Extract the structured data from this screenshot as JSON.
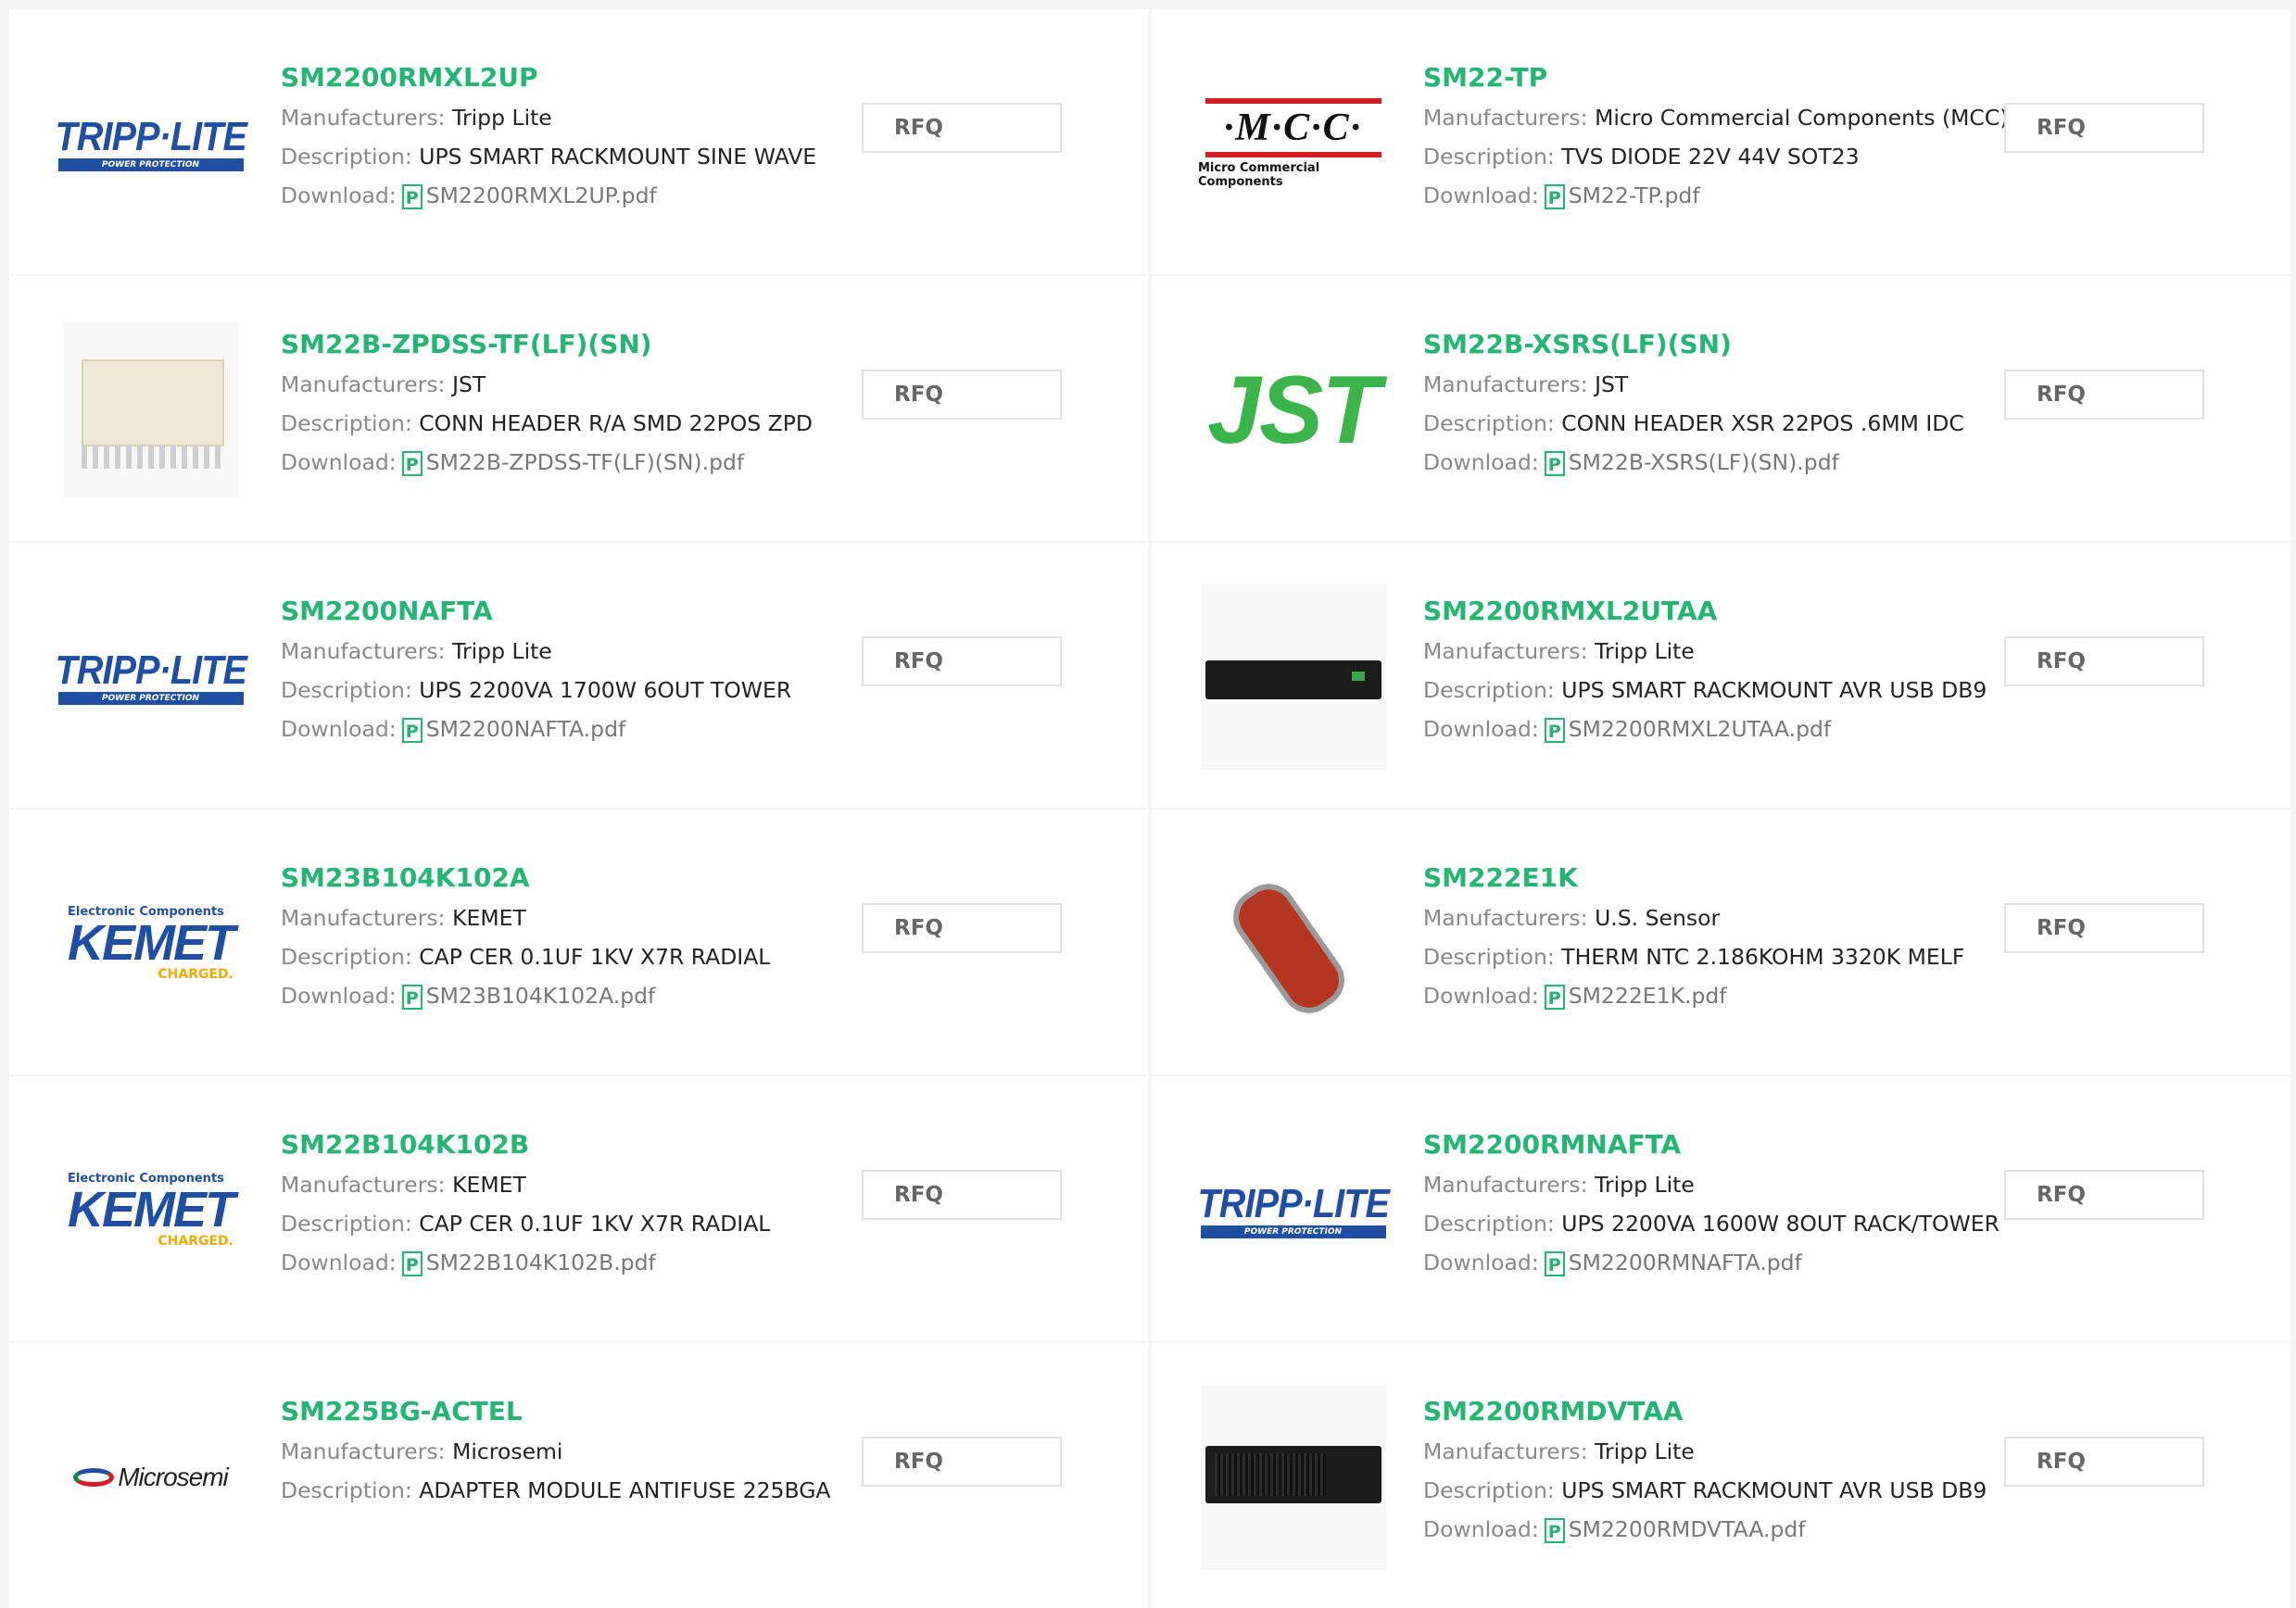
{
  "labels": {
    "manufacturers": "Manufacturers:",
    "description": "Description:",
    "download": "Download:",
    "rfq": "RFQ",
    "pdf_glyph": "P"
  },
  "colors": {
    "accent": "#22b573",
    "label": "#888888",
    "text": "#222222"
  },
  "products": [
    {
      "part": "SM2200RMXL2UP",
      "manufacturer": "Tripp Lite",
      "description": "UPS SMART RACKMOUNT SINE WAVE",
      "download": "SM2200RMXL2UP.pdf",
      "logo": "tripp-lite-logo",
      "logo_sub": "POWER PROTECTION"
    },
    {
      "part": "SM22-TP",
      "manufacturer": "Micro Commercial Components (MCC)",
      "description": "TVS DIODE 22V 44V SOT23",
      "download": "SM22-TP.pdf",
      "logo": "mcc-logo",
      "logo_text": "·M·C·C·",
      "logo_sub": "Micro Commercial Components"
    },
    {
      "part": "SM22B-ZPDSS-TF(LF)(SN)",
      "manufacturer": "JST",
      "description": "CONN HEADER R/A SMD 22POS ZPD",
      "download": "SM22B-ZPDSS-TF(LF)(SN).pdf",
      "logo": "connector-photo"
    },
    {
      "part": "SM22B-XSRS(LF)(SN)",
      "manufacturer": "JST",
      "description": "CONN HEADER XSR 22POS .6MM IDC",
      "download": "SM22B-XSRS(LF)(SN).pdf",
      "logo": "jst-logo",
      "logo_text": "JST"
    },
    {
      "part": "SM2200NAFTA",
      "manufacturer": "Tripp Lite",
      "description": "UPS 2200VA 1700W 6OUT TOWER",
      "download": "SM2200NAFTA.pdf",
      "logo": "tripp-lite-logo",
      "logo_sub": "POWER PROTECTION"
    },
    {
      "part": "SM2200RMXL2UTAA",
      "manufacturer": "Tripp Lite",
      "description": "UPS SMART RACKMOUNT AVR USB DB9",
      "download": "SM2200RMXL2UTAA.pdf",
      "logo": "ups-rack-photo"
    },
    {
      "part": "SM23B104K102A",
      "manufacturer": "KEMET",
      "description": "CAP CER 0.1UF 1KV X7R RADIAL",
      "download": "SM23B104K102A.pdf",
      "logo": "kemet-logo",
      "logo_top": "Electronic Components",
      "logo_text": "KEMET",
      "logo_sub": "CHARGED."
    },
    {
      "part": "SM222E1K",
      "manufacturer": "U.S. Sensor",
      "description": "THERM NTC 2.186KOHM 3320K MELF",
      "download": "SM222E1K.pdf",
      "logo": "thermistor-photo"
    },
    {
      "part": "SM22B104K102B",
      "manufacturer": "KEMET",
      "description": "CAP CER 0.1UF 1KV X7R RADIAL",
      "download": "SM22B104K102B.pdf",
      "logo": "kemet-logo",
      "logo_top": "Electronic Components",
      "logo_text": "KEMET",
      "logo_sub": "CHARGED."
    },
    {
      "part": "SM2200RMNAFTA",
      "manufacturer": "Tripp Lite",
      "description": "UPS 2200VA 1600W 8OUT RACK/TOWER",
      "download": "SM2200RMNAFTA.pdf",
      "logo": "tripp-lite-logo",
      "logo_sub": "POWER PROTECTION"
    },
    {
      "part": "SM225BG-ACTEL",
      "manufacturer": "Microsemi",
      "description": "ADAPTER MODULE ANTIFUSE 225BGA",
      "download": null,
      "logo": "microsemi-logo",
      "logo_text": "Microsemi"
    },
    {
      "part": "SM2200RMDVTAA",
      "manufacturer": "Tripp Lite",
      "description": "UPS SMART RACKMOUNT AVR USB DB9",
      "download": "SM2200RMDVTAA.pdf",
      "logo": "ups-rack-photo-tall"
    }
  ]
}
